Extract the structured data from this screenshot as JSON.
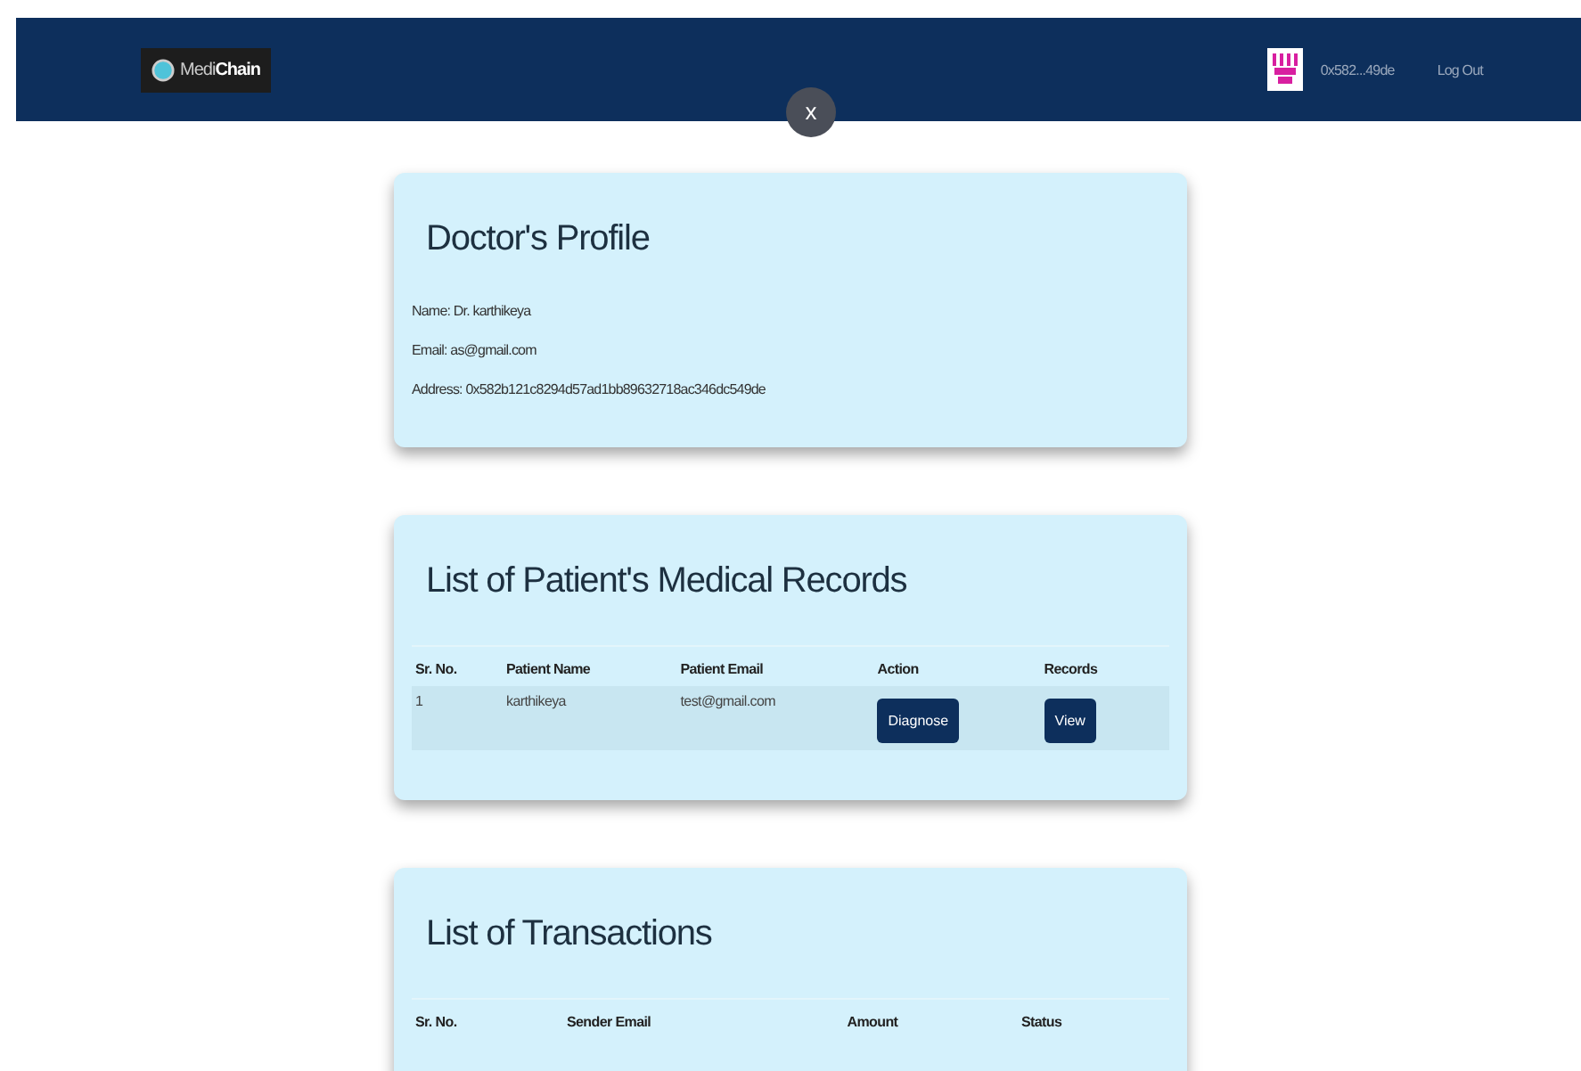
{
  "navbar": {
    "logo": "Medi**Chain**",
    "account": "0x582...49de",
    "logout": "Log Out",
    "close": "x"
  },
  "profile": {
    "title": "Doctor's Profile",
    "lines": [
      "Name: Dr. karthikeya",
      "Email: as@gmail.com",
      "Address: 0x582b121c8294d57ad1bb89632718ac346dc549de"
    ]
  },
  "records": {
    "title": "List of Patient's Medical Records",
    "columns": [
      "Sr. No.",
      "Patient Name",
      "Patient Email",
      "Action",
      "Records"
    ],
    "rows": [
      [
        {
          "kind": "text",
          "text": "1"
        },
        {
          "kind": "text",
          "text": "karthikeya"
        },
        {
          "kind": "text",
          "text": "test@gmail.com"
        },
        {
          "kind": "button",
          "text": "Diagnose"
        },
        {
          "kind": "button",
          "text": "View"
        }
      ]
    ]
  },
  "transactions": {
    "title": "List of Transactions",
    "columns": [
      "Sr. No.",
      "Sender Email",
      "Amount",
      "Status"
    ]
  }
}
